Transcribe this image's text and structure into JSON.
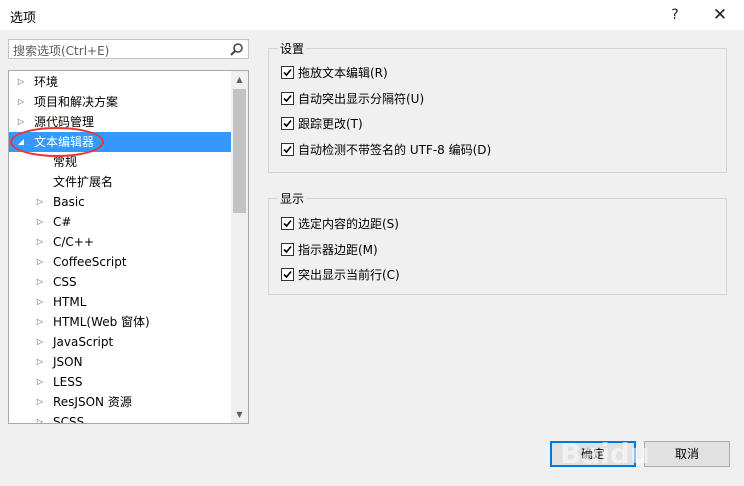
{
  "window": {
    "title": "选项",
    "help": "?",
    "close": "✕"
  },
  "search": {
    "placeholder": "搜索选项(Ctrl+E)"
  },
  "tree": {
    "items": [
      {
        "label": "环境",
        "arrow": "▷"
      },
      {
        "label": "项目和解决方案",
        "arrow": "▷"
      },
      {
        "label": "源代码管理",
        "arrow": "▷"
      },
      {
        "label": "文本编辑器",
        "arrow": "◢"
      },
      {
        "label": "常规",
        "arrow": ""
      },
      {
        "label": "文件扩展名",
        "arrow": ""
      },
      {
        "label": "Basic",
        "arrow": "▷"
      },
      {
        "label": "C#",
        "arrow": "▷"
      },
      {
        "label": "C/C++",
        "arrow": "▷"
      },
      {
        "label": "CoffeeScript",
        "arrow": "▷"
      },
      {
        "label": "CSS",
        "arrow": "▷"
      },
      {
        "label": "HTML",
        "arrow": "▷"
      },
      {
        "label": "HTML(Web 窗体)",
        "arrow": "▷"
      },
      {
        "label": "JavaScript",
        "arrow": "▷"
      },
      {
        "label": "JSON",
        "arrow": "▷"
      },
      {
        "label": "LESS",
        "arrow": "▷"
      },
      {
        "label": "ResJSON 资源",
        "arrow": "▷"
      },
      {
        "label": "SCSS",
        "arrow": "▷"
      }
    ],
    "scroll_up": "▲",
    "scroll_down": "▼"
  },
  "settings": {
    "title": "设置",
    "items": [
      {
        "label": "拖放文本编辑(R)",
        "checked": true
      },
      {
        "label": "自动突出显示分隔符(U)",
        "checked": true
      },
      {
        "label": "跟踪更改(T)",
        "checked": true
      },
      {
        "label": "自动检测不带签名的 UTF-8 编码(D)",
        "checked": true
      }
    ]
  },
  "display": {
    "title": "显示",
    "items": [
      {
        "label": "选定内容的边距(S)",
        "checked": true
      },
      {
        "label": "指示器边距(M)",
        "checked": true
      },
      {
        "label": "突出显示当前行(C)",
        "checked": true
      }
    ]
  },
  "buttons": {
    "ok": "确定",
    "cancel": "取消"
  },
  "watermark": "Baidu"
}
